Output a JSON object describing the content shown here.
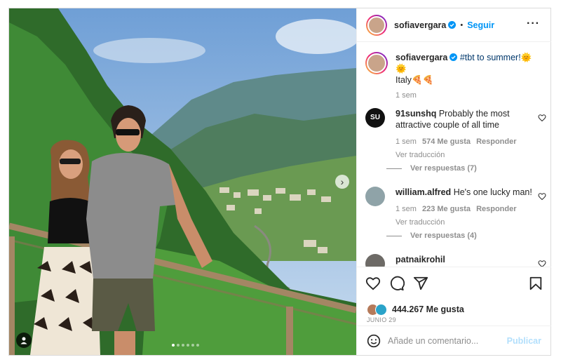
{
  "post": {
    "username": "sofiavergara",
    "follow_label": "Seguir",
    "dot": "•",
    "caption_tag": "#tbt to summer!",
    "caption_emoji": "🌞🌞",
    "caption_line2": "Italy",
    "caption_line2_emoji": "🍕🍕",
    "caption_time": "1 sem",
    "likes": "444.267 Me gusta",
    "date": "JUNIO 29",
    "add_comment_placeholder": "Añade un comentario...",
    "publish_label": "Publicar"
  },
  "comments": [
    {
      "user": "91sunshq",
      "text": "Probably the most attractive couple of all time",
      "time": "1 sem",
      "likes": "574 Me gusta",
      "reply": "Responder",
      "translate": "Ver traducción",
      "view_replies": "Ver respuestas (7)"
    },
    {
      "user": "william.alfred",
      "text": "He's one lucky man!",
      "time": "1 sem",
      "likes": "223 Me gusta",
      "reply": "Responder",
      "translate": "Ver traducción",
      "view_replies": "Ver respuestas (4)"
    },
    {
      "user": "patnaikrohil",
      "text": ""
    }
  ],
  "icons": {
    "more": "more-options-icon",
    "heart": "heart-icon",
    "comment": "comment-icon",
    "share": "share-icon",
    "save": "bookmark-icon",
    "emoji": "emoji-icon",
    "next": "chevron-right-icon",
    "tag": "user-tag-icon"
  },
  "colors": {
    "accent": "#0095f6",
    "muted": "#8e8e8e",
    "publish_disabled": "#b2dffc"
  }
}
